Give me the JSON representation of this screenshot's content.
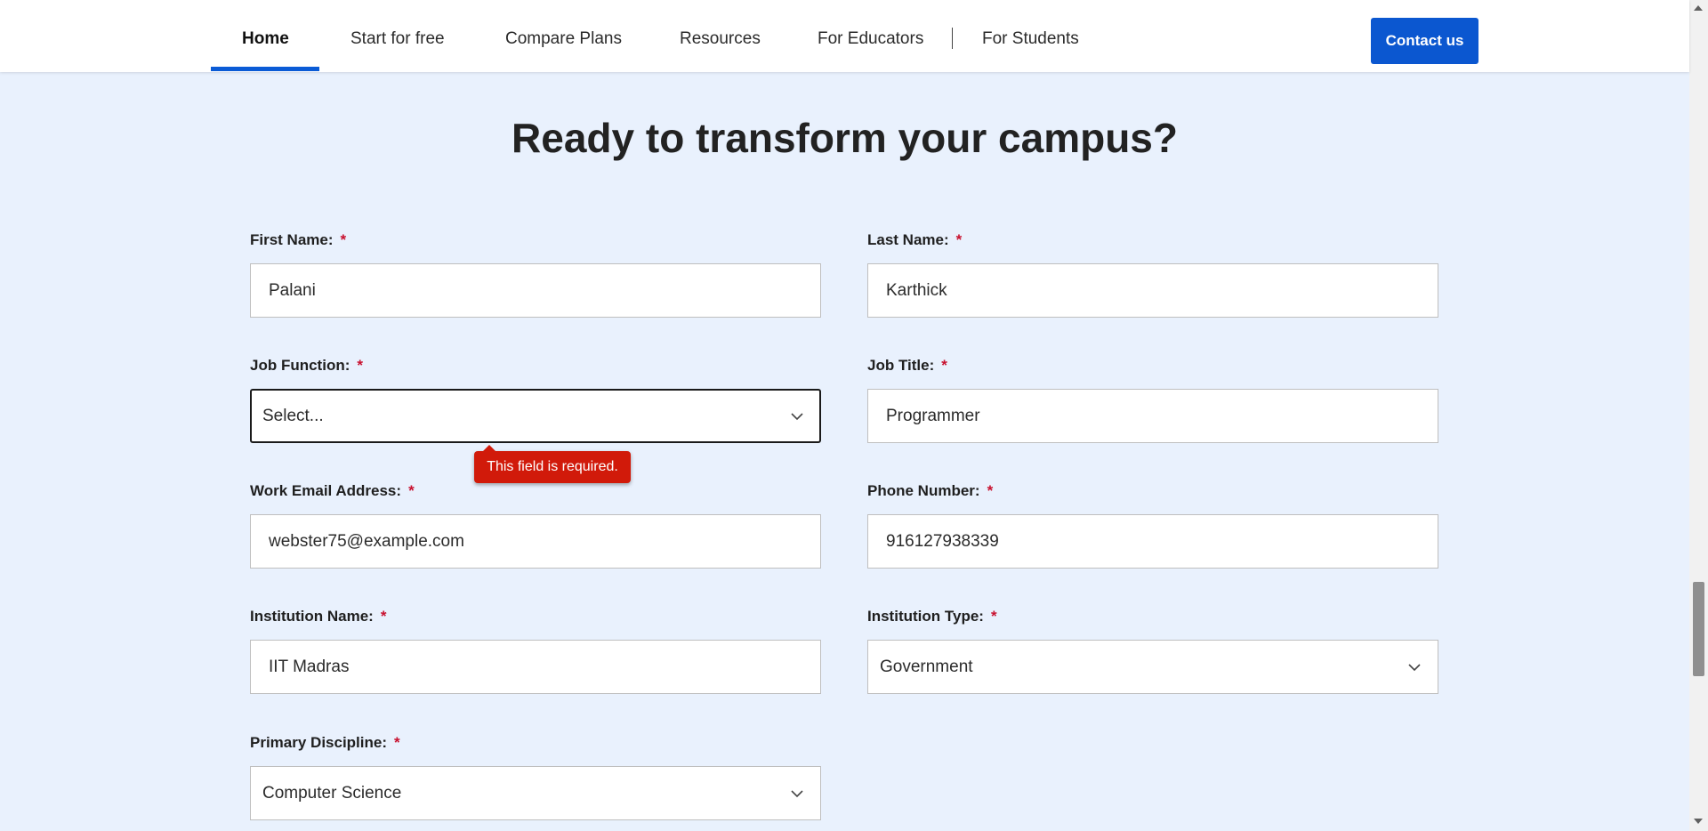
{
  "nav": {
    "items": [
      {
        "label": "Home",
        "active": true
      },
      {
        "label": "Start for free"
      },
      {
        "label": "Compare Plans"
      },
      {
        "label": "Resources"
      },
      {
        "label": "For Educators"
      },
      {
        "label": "For Students"
      }
    ],
    "separator": "|",
    "contact_label": "Contact us"
  },
  "heading": "Ready to transform your campus?",
  "form": {
    "required_marker": "*",
    "first_name": {
      "label": "First Name:",
      "value": "Palani"
    },
    "last_name": {
      "label": "Last Name:",
      "value": "Karthick"
    },
    "job_function": {
      "label": "Job Function:",
      "value": "Select...",
      "error": "This field is required."
    },
    "job_title": {
      "label": "Job Title:",
      "value": "Programmer"
    },
    "work_email": {
      "label": "Work Email Address:",
      "value": "webster75@example.com"
    },
    "phone": {
      "label": "Phone Number:",
      "value": "916127938339"
    },
    "institution_name": {
      "label": "Institution Name:",
      "value": "IIT Madras"
    },
    "institution_type": {
      "label": "Institution Type:",
      "value": "Government"
    },
    "primary_discipline": {
      "label": "Primary Discipline:",
      "value": "Computer Science"
    }
  },
  "colors": {
    "accent": "#0b57d0",
    "page_background": "#e9f1fd",
    "error": "#d11a0a",
    "required": "#c8102e"
  }
}
